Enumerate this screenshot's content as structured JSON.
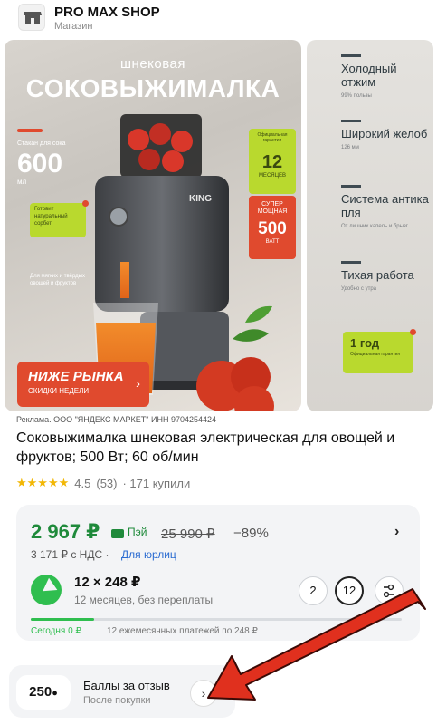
{
  "header": {
    "shop_name": "PRO MAX SHOP",
    "shop_type": "Магазин",
    "logo_icon": "storefront-icon"
  },
  "gallery": {
    "slide1": {
      "subtitle": "шнековая",
      "title": "СОКОВЫЖИМАЛКА",
      "stat_label": "Стакан для сока",
      "stat_value": "600",
      "stat_unit": "мл",
      "sorbet": "Готовит натуральный сорбет",
      "for_fruits": "Для мягких и твёрдых овощей и фруктов",
      "guarantee_label": "Официальная гарантия",
      "guarantee_value": "12",
      "guarantee_unit": "МЕСЯЦЕВ",
      "power_label": "СУПЕР МОЩНАЯ",
      "power_value": "500",
      "power_unit": "ВАТТ",
      "cta_title": "НИЖЕ РЫНКА",
      "cta_sub": "СКИДКИ НЕДЕЛИ",
      "brand": "KING"
    },
    "slide2": {
      "items": [
        {
          "title": "Холодный отжим",
          "sub": "99% пользы"
        },
        {
          "title": "Широкий желоб",
          "sub": "126 мм"
        },
        {
          "title": "Система антика пля",
          "sub": "От лишних капель и брызг"
        },
        {
          "title": "Тихая работа",
          "sub": "Удобно с утра"
        }
      ],
      "badge_title": "1 год",
      "badge_sub": "Официальная гарантия"
    }
  },
  "ad_line": "Реклама. ООО \"ЯНДЕКС МАРКЕТ\" ИНН 9704254424",
  "product": {
    "title": "Соковыжималка шнековая электрическая для овощей и фруктов; 500 Вт; 60 об/мин",
    "stars": "★★★★★",
    "rating": "4.5",
    "reviews": "(53)",
    "bought": "· 171 купили"
  },
  "price": {
    "current": "2 967 ₽",
    "pay_label": "Пэй",
    "old": "25 990 ₽",
    "discount": "−89%",
    "vat": "3 171 ₽ с НДС ·",
    "legal_link": "Для юрлиц",
    "split_main": "12 × 248 ₽",
    "split_sub": "12 месяцев, без переплаты",
    "option_2": "2",
    "option_12": "12",
    "today": "Сегодня 0 ₽",
    "monthly": "12 ежемесячных платежей по 248 ₽",
    "progress_fraction": 0.17
  },
  "bonus": {
    "points": "250",
    "title": "Баллы за отзыв",
    "sub": "После покупки"
  },
  "colors": {
    "green_price": "#1f8a3b",
    "accent_red": "#e04a2e",
    "lime": "#b9d92e",
    "split_green": "#2fbe4f",
    "link_blue": "#2a6bd1"
  }
}
